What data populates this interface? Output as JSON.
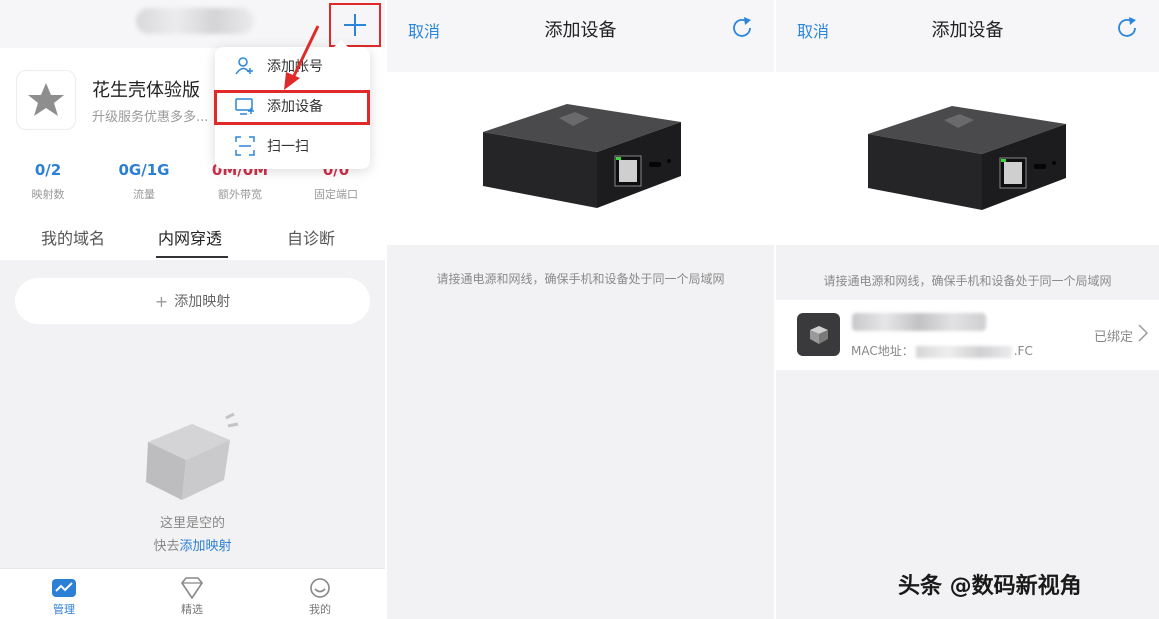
{
  "panel1": {
    "profile": {
      "name": "花生壳体验版",
      "subtitle": "升级服务优惠多多..."
    },
    "stats": [
      {
        "value": "0/2",
        "label": "映射数"
      },
      {
        "value": "0G/1G",
        "label": "流量"
      },
      {
        "value": "0M/0M",
        "label": "额外带宽"
      },
      {
        "value": "0/0",
        "label": "固定端口"
      }
    ],
    "tabs": [
      {
        "label": "我的域名"
      },
      {
        "label": "内网穿透"
      },
      {
        "label": "自诊断"
      }
    ],
    "add_mapping": "添加映射",
    "empty": {
      "line1": "这里是空的",
      "prefix": "快去",
      "link": "添加映射"
    },
    "menu": [
      {
        "label": "添加帐号",
        "icon": "add-user-icon"
      },
      {
        "label": "添加设备",
        "icon": "add-device-icon"
      },
      {
        "label": "扫一扫",
        "icon": "scan-icon"
      }
    ],
    "bottom_nav": [
      {
        "label": "管理",
        "icon": "manage-icon"
      },
      {
        "label": "精选",
        "icon": "diamond-icon"
      },
      {
        "label": "我的",
        "icon": "profile-icon"
      }
    ],
    "colors": {
      "accent": "#2b86db",
      "highlight": "#e02a2a",
      "stat_red": "#d0304a"
    }
  },
  "panel2": {
    "cancel": "取消",
    "title": "添加设备",
    "hint": "请接通电源和网线，确保手机和设备处于同一个局域网"
  },
  "panel3": {
    "cancel": "取消",
    "title": "添加设备",
    "hint": "请接通电源和网线，确保手机和设备处于同一个局域网",
    "device": {
      "mac_label": "MAC地址：",
      "mac_suffix": ".FC",
      "status": "已绑定"
    }
  },
  "watermark": "头条 @数码新视角"
}
